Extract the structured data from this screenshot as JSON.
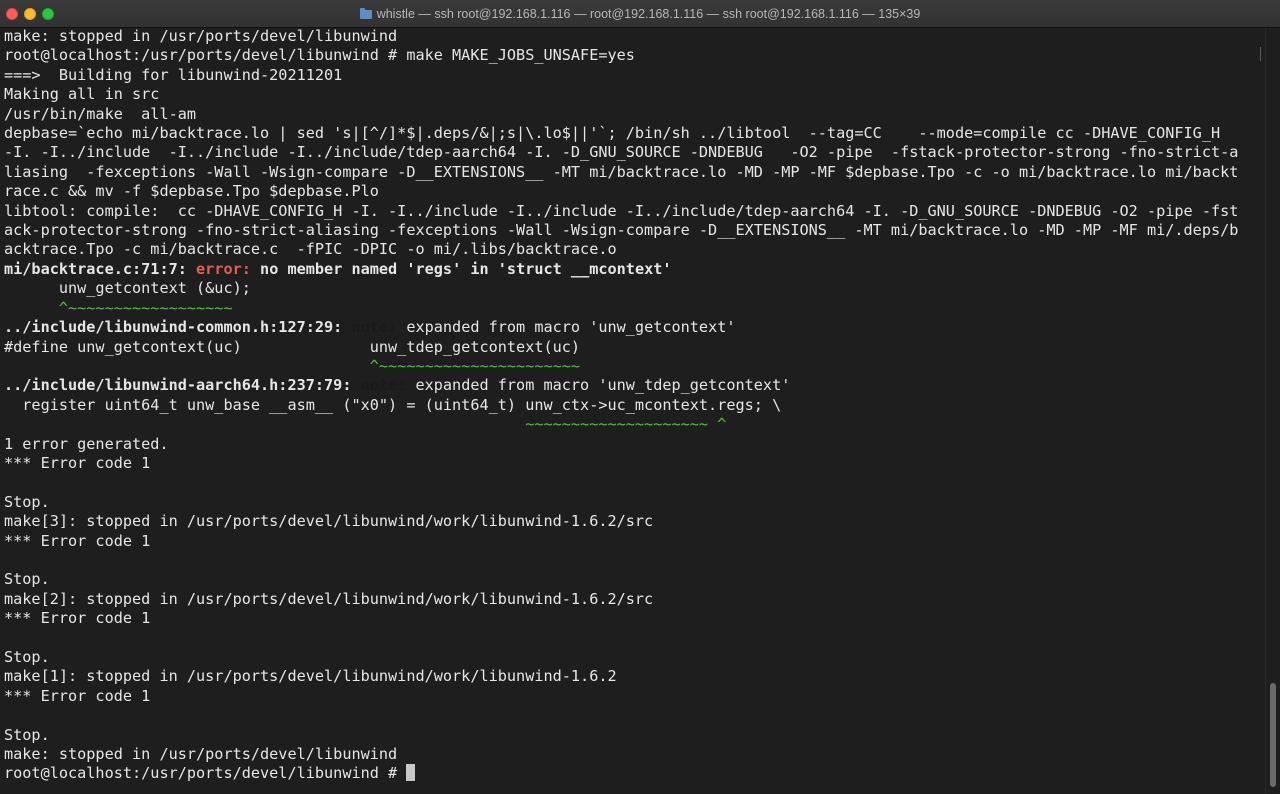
{
  "window": {
    "title": "whistle — ssh root@192.168.1.116 — root@192.168.1.116 — ssh root@192.168.1.116 — 135×39",
    "folder_icon": "folder-icon",
    "traffic_lights": [
      "close",
      "minimize",
      "zoom"
    ]
  },
  "colors": {
    "background": "#1e1e1e",
    "text": "#e6e6e6",
    "error": "#e35f4b",
    "caret": "#4fc33c"
  },
  "terminal": {
    "lines": [
      [
        {
          "t": "make: stopped in /usr/ports/devel/libunwind"
        }
      ],
      [
        {
          "t": "root@localhost:/usr/ports/devel/libunwind # make MAKE_JOBS_UNSAFE=yes"
        }
      ],
      [
        {
          "t": "===>  Building for libunwind-20211201"
        }
      ],
      [
        {
          "t": "Making all in src"
        }
      ],
      [
        {
          "t": "/usr/bin/make  all-am"
        }
      ],
      [
        {
          "t": "depbase=`echo mi/backtrace.lo | sed 's|[^/]*$|.deps/&|;s|\\.lo$||'`; /bin/sh ../libtool  --tag=CC    --mode=compile cc -DHAVE_CONFIG_H"
        }
      ],
      [
        {
          "t": "-I. -I../include  -I../include -I../include/tdep-aarch64 -I. -D_GNU_SOURCE -DNDEBUG   -O2 -pipe  -fstack-protector-strong -fno-strict-a"
        }
      ],
      [
        {
          "t": "liasing  -fexceptions -Wall -Wsign-compare -D__EXTENSIONS__ -MT mi/backtrace.lo -MD -MP -MF $depbase.Tpo -c -o mi/backtrace.lo mi/backt"
        }
      ],
      [
        {
          "t": "race.c && mv -f $depbase.Tpo $depbase.Plo"
        }
      ],
      [
        {
          "t": "libtool: compile:  cc -DHAVE_CONFIG_H -I. -I../include -I../include -I../include/tdep-aarch64 -I. -D_GNU_SOURCE -DNDEBUG -O2 -pipe -fst"
        }
      ],
      [
        {
          "t": "ack-protector-strong -fno-strict-aliasing -fexceptions -Wall -Wsign-compare -D__EXTENSIONS__ -MT mi/backtrace.lo -MD -MP -MF mi/.deps/b"
        }
      ],
      [
        {
          "t": "acktrace.Tpo -c mi/backtrace.c  -fPIC -DPIC -o mi/.libs/backtrace.o"
        }
      ],
      [
        {
          "t": "mi/backtrace.c:71:7: ",
          "s": "b"
        },
        {
          "t": "error:",
          "s": "err"
        },
        {
          "t": " no member named 'regs' in 'struct __mcontext'",
          "s": "b"
        }
      ],
      [
        {
          "t": "      unw_getcontext (&uc);"
        }
      ],
      [
        {
          "t": "      ^~~~~~~~~~~~~~~~~~~",
          "s": "caret"
        }
      ],
      [
        {
          "t": "../include/libunwind-common.h:127:29: ",
          "s": "b"
        },
        {
          "t": "note:",
          "s": "note"
        },
        {
          "t": " expanded from macro 'unw_getcontext'"
        }
      ],
      [
        {
          "t": "#define unw_getcontext(uc)              unw_tdep_getcontext(uc)"
        }
      ],
      [
        {
          "t": "                                        ^~~~~~~~~~~~~~~~~~~~~~~",
          "s": "caret"
        }
      ],
      [
        {
          "t": "../include/libunwind-aarch64.h:237:79: ",
          "s": "b"
        },
        {
          "t": "note:",
          "s": "note"
        },
        {
          "t": " expanded from macro 'unw_tdep_getcontext'"
        }
      ],
      [
        {
          "t": "  register uint64_t unw_base __asm__ (\"x0\") = (uint64_t) unw_ctx->uc_mcontext.regs; \\"
        }
      ],
      [
        {
          "t": "                                                         ~~~~~~~~~~~~~~~~~~~~ ^",
          "s": "caret"
        }
      ],
      [
        {
          "t": "1 error generated."
        }
      ],
      [
        {
          "t": "*** Error code 1"
        }
      ],
      [
        {
          "t": ""
        }
      ],
      [
        {
          "t": "Stop."
        }
      ],
      [
        {
          "t": "make[3]: stopped in /usr/ports/devel/libunwind/work/libunwind-1.6.2/src"
        }
      ],
      [
        {
          "t": "*** Error code 1"
        }
      ],
      [
        {
          "t": ""
        }
      ],
      [
        {
          "t": "Stop."
        }
      ],
      [
        {
          "t": "make[2]: stopped in /usr/ports/devel/libunwind/work/libunwind-1.6.2/src"
        }
      ],
      [
        {
          "t": "*** Error code 1"
        }
      ],
      [
        {
          "t": ""
        }
      ],
      [
        {
          "t": "Stop."
        }
      ],
      [
        {
          "t": "make[1]: stopped in /usr/ports/devel/libunwind/work/libunwind-1.6.2"
        }
      ],
      [
        {
          "t": "*** Error code 1"
        }
      ],
      [
        {
          "t": ""
        }
      ],
      [
        {
          "t": "Stop."
        }
      ],
      [
        {
          "t": "make: stopped in /usr/ports/devel/libunwind"
        }
      ]
    ],
    "prompt": "root@localhost:/usr/ports/devel/libunwind # "
  },
  "scrollbar": {
    "position_fraction": 1.0
  }
}
